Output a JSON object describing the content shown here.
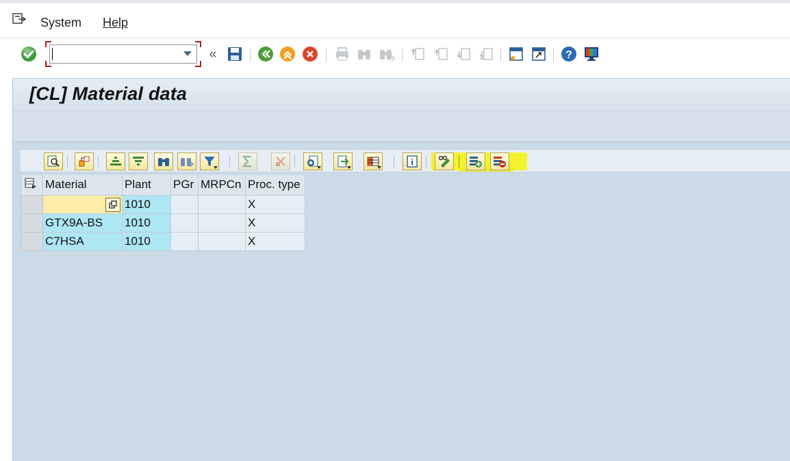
{
  "menu": {
    "items": [
      {
        "label": "System"
      },
      {
        "label": "Help"
      }
    ]
  },
  "toolbar": {
    "command_field": {
      "value": "",
      "placeholder": ""
    },
    "icons": [
      "enter-icon",
      "collapse-icon",
      "save-icon",
      "back-icon",
      "exit-icon",
      "cancel-icon",
      "print-icon",
      "find-icon",
      "find-next-icon",
      "first-page-icon",
      "previous-page-icon",
      "next-page-icon",
      "last-page-icon",
      "create-session-icon",
      "generate-shortcut-icon",
      "help-icon",
      "customize-layout-icon"
    ]
  },
  "page": {
    "title": "[CL] Material data"
  },
  "alv_toolbar": {
    "buttons": [
      "details-icon",
      "check-icon",
      "sort-ascending-icon",
      "sort-descending-icon",
      "find-icon",
      "find-next-icon",
      "filter-icon",
      "total-icon",
      "subtotal-icon",
      "print-preview-icon",
      "export-icon",
      "layout-icon",
      "information-icon",
      "documentation-icon",
      "insert-row-icon",
      "delete-row-icon"
    ],
    "highlight_color": "#f4f22b"
  },
  "table": {
    "columns": [
      "Material",
      "Plant",
      "PGr",
      "MRPCn",
      "Proc. type"
    ],
    "rows": [
      {
        "material": "",
        "plant": "1010",
        "pgr": "",
        "mrpcn": "",
        "proc_type": "X"
      },
      {
        "material": "GTX9A-BS",
        "plant": "1010",
        "pgr": "",
        "mrpcn": "",
        "proc_type": "X"
      },
      {
        "material": "C7HSA",
        "plant": "1010",
        "pgr": "",
        "mrpcn": "",
        "proc_type": "X"
      }
    ]
  },
  "colors": {
    "key_cell": "#aee6f3",
    "editing_cell": "#ffeca8",
    "screen_bg": "#ccd9e6",
    "accent_red": "#b01c1c"
  }
}
